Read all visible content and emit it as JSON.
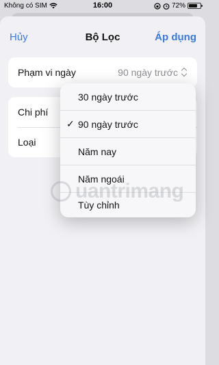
{
  "status_bar": {
    "carrier": "Không có SIM",
    "time": "16:00",
    "battery": "72%",
    "battery_level": 0.72
  },
  "nav": {
    "cancel": "Hủy",
    "title": "Bộ Lọc",
    "apply": "Áp dụng"
  },
  "filters": {
    "date_range": {
      "label": "Phạm vi ngày",
      "value": "90 ngày trước"
    },
    "cost": {
      "label": "Chi phí"
    },
    "type": {
      "label": "Loại"
    }
  },
  "menu": {
    "items": [
      {
        "label": "30 ngày trước",
        "selected": false
      },
      {
        "label": "90 ngày trước",
        "selected": true
      },
      {
        "label": "Năm nay",
        "selected": false
      },
      {
        "label": "Năm ngoái",
        "selected": false
      },
      {
        "label": "Tùy chỉnh",
        "selected": false
      }
    ],
    "check_glyph": "✓"
  },
  "watermark": "uantrimang",
  "colors": {
    "accent": "#3a7ad8",
    "sheet_background": "#f1f1f5",
    "secondary_text": "#8e8e93"
  }
}
